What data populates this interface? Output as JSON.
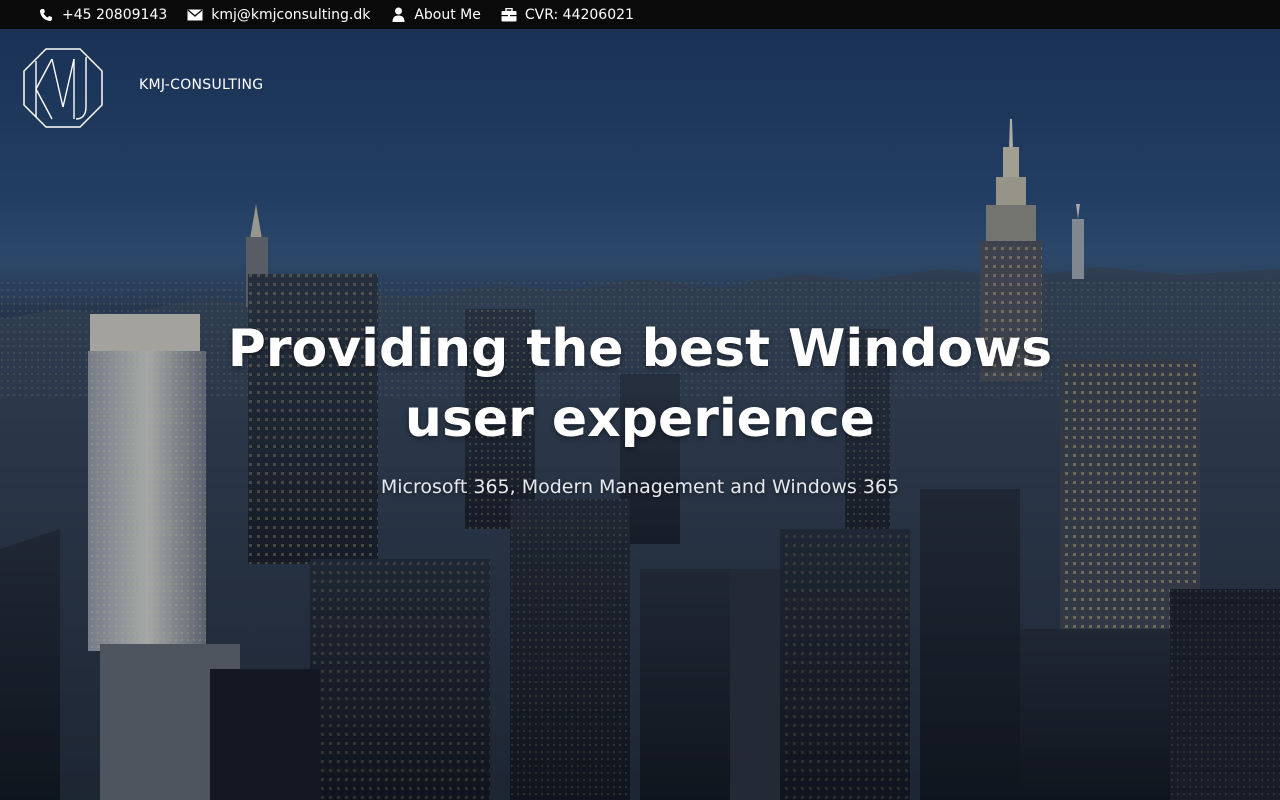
{
  "topbar": {
    "phone": {
      "icon": "phone-icon",
      "text": "+45 20809143"
    },
    "email": {
      "icon": "envelope-icon",
      "text": "kmj@kmjconsulting.dk"
    },
    "about": {
      "icon": "user-icon",
      "text": "About Me"
    },
    "cvr": {
      "icon": "briefcase-icon",
      "text": "CVR: 44206021"
    }
  },
  "brand": {
    "logo_icon": "kmj-monogram-logo",
    "name": "KMJ-CONSULTING"
  },
  "hero": {
    "title": "Providing the best Windows user experience",
    "subtitle": "Microsoft 365, Modern Management and Windows 365",
    "background": "night-city-skyline-image"
  },
  "colors": {
    "topbar_bg": "#0a0a0a",
    "text": "#ffffff",
    "sky_top": "#1e3a63"
  }
}
